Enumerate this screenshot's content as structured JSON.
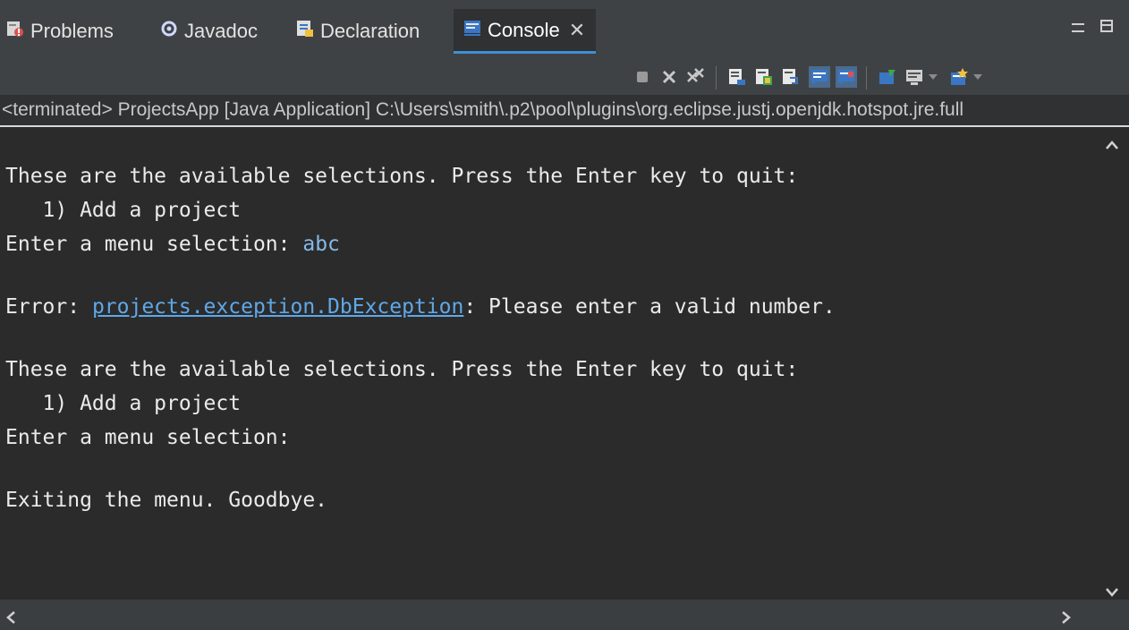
{
  "tabs": [
    {
      "label": "Problems",
      "icon": "problems-icon"
    },
    {
      "label": "Javadoc",
      "icon": "javadoc-icon"
    },
    {
      "label": "Declaration",
      "icon": "declaration-icon"
    },
    {
      "label": "Console",
      "icon": "console-icon",
      "active": true
    }
  ],
  "status": {
    "text": "<terminated> ProjectsApp [Java Application] C:\\Users\\smith\\.p2\\pool\\plugins\\org.eclipse.justj.openjdk.hotspot.jre.full"
  },
  "console": {
    "lines": [
      {
        "text": "These are the available selections. Press the Enter key to quit:"
      },
      {
        "text": "   1) Add a project"
      },
      {
        "text": "Enter a menu selection: ",
        "input": "abc"
      },
      {
        "text": ""
      },
      {
        "prefix": "Error: ",
        "link": "projects.exception.DbException",
        "suffix": ": Please enter a valid number."
      },
      {
        "text": ""
      },
      {
        "text": "These are the available selections. Press the Enter key to quit:"
      },
      {
        "text": "   1) Add a project"
      },
      {
        "text": "Enter a menu selection:"
      },
      {
        "text": ""
      },
      {
        "text": "Exiting the menu. Goodbye."
      }
    ]
  },
  "colors": {
    "background": "#2b2b2b",
    "text": "#ebebeb",
    "input": "#86b9e6",
    "link": "#5fa8e8",
    "active_tab_underline": "#3f8fd5"
  }
}
